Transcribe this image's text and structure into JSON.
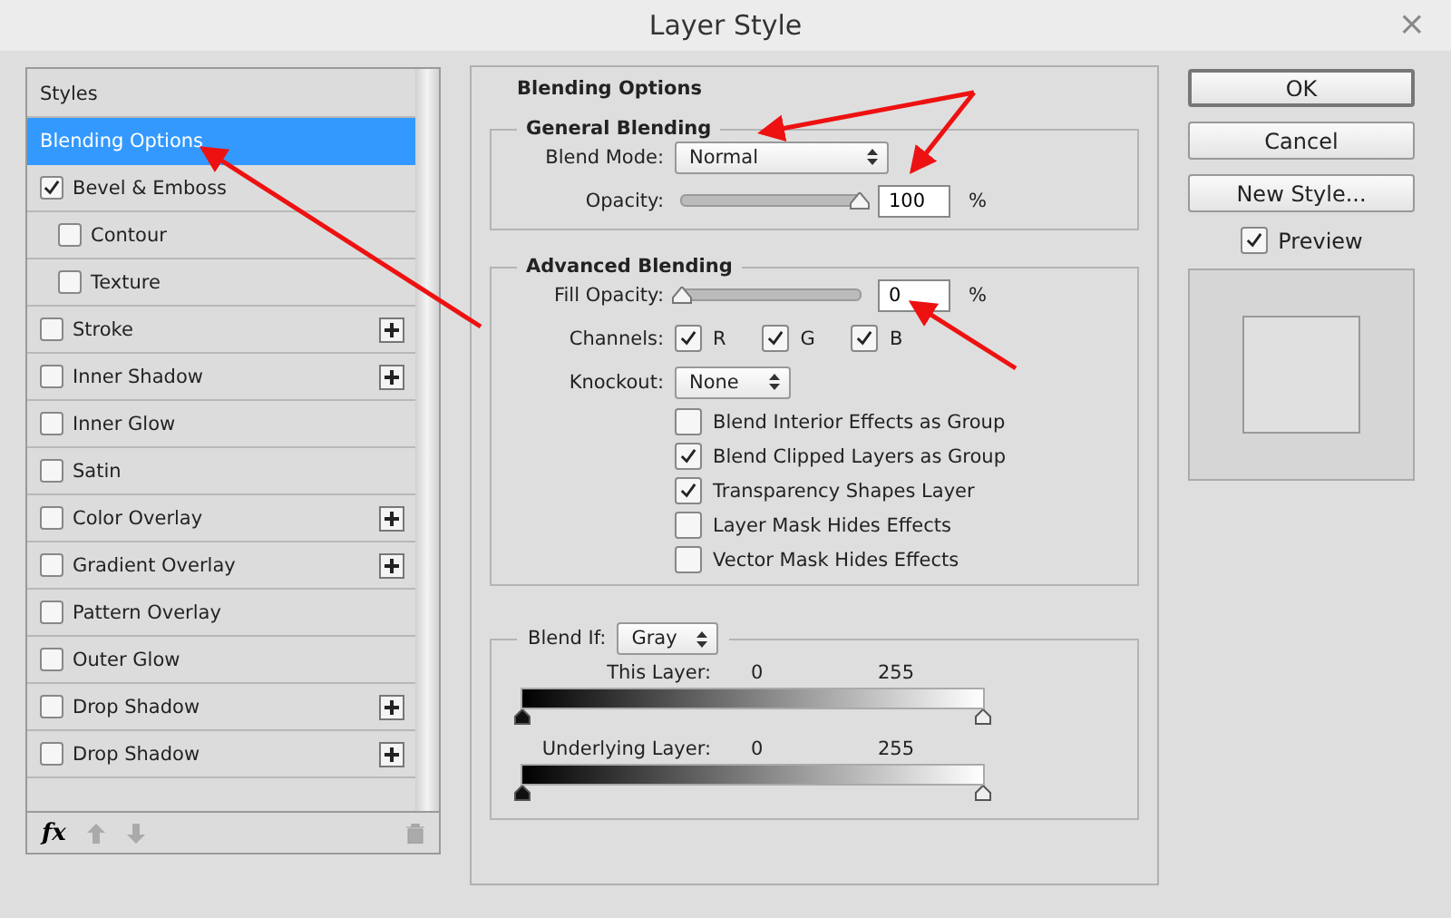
{
  "window": {
    "title": "Layer Style",
    "close": "×"
  },
  "sidebar": {
    "items": [
      {
        "kind": "header",
        "label": "Styles",
        "selected": false
      },
      {
        "kind": "header",
        "label": "Blending Options",
        "selected": true
      },
      {
        "kind": "effect",
        "label": "Bevel & Emboss",
        "checked": true,
        "selected": false,
        "add": false,
        "children": [
          {
            "kind": "effect",
            "label": "Contour",
            "checked": false,
            "selected": false,
            "add": false
          },
          {
            "kind": "effect",
            "label": "Texture",
            "checked": false,
            "selected": false,
            "add": false
          }
        ]
      },
      {
        "kind": "effect",
        "label": "Stroke",
        "checked": false,
        "selected": false,
        "add": true
      },
      {
        "kind": "effect",
        "label": "Inner Shadow",
        "checked": false,
        "selected": false,
        "add": true
      },
      {
        "kind": "effect",
        "label": "Inner Glow",
        "checked": false,
        "selected": false,
        "add": false
      },
      {
        "kind": "effect",
        "label": "Satin",
        "checked": false,
        "selected": false,
        "add": false
      },
      {
        "kind": "effect",
        "label": "Color Overlay",
        "checked": false,
        "selected": false,
        "add": true
      },
      {
        "kind": "effect",
        "label": "Gradient Overlay",
        "checked": false,
        "selected": false,
        "add": true
      },
      {
        "kind": "effect",
        "label": "Pattern Overlay",
        "checked": false,
        "selected": false,
        "add": false
      },
      {
        "kind": "effect",
        "label": "Outer Glow",
        "checked": false,
        "selected": false,
        "add": false
      },
      {
        "kind": "effect",
        "label": "Drop Shadow",
        "checked": false,
        "selected": false,
        "add": true
      },
      {
        "kind": "effect",
        "label": "Drop Shadow",
        "checked": false,
        "selected": false,
        "add": true
      }
    ],
    "footer": {
      "fx": "fx"
    }
  },
  "blending_options": {
    "title": "Blending Options",
    "general": {
      "title": "General Blending",
      "blend_mode": {
        "label": "Blend Mode:",
        "value": "Normal"
      },
      "opacity": {
        "label": "Opacity:",
        "level": 1,
        "value": "100",
        "unit": "%"
      }
    },
    "advanced": {
      "title": "Advanced Blending",
      "fill_opacity": {
        "label": "Fill Opacity:",
        "level": 0,
        "value": "0",
        "unit": "%"
      },
      "channels": {
        "label": "Channels:",
        "items": [
          {
            "label": "R",
            "checked": true
          },
          {
            "label": "G",
            "checked": true
          },
          {
            "label": "B",
            "checked": true
          }
        ]
      },
      "knockout": {
        "label": "Knockout:",
        "value": "None"
      },
      "options": [
        {
          "label": "Blend Interior Effects as Group",
          "checked": false
        },
        {
          "label": "Blend Clipped Layers as Group",
          "checked": true
        },
        {
          "label": "Transparency Shapes Layer",
          "checked": true
        },
        {
          "label": "Layer Mask Hides Effects",
          "checked": false
        },
        {
          "label": "Vector Mask Hides Effects",
          "checked": false
        }
      ]
    },
    "blend_if": {
      "label": "Blend If:",
      "value": "Gray",
      "layers": [
        {
          "label": "This Layer:",
          "low": "0",
          "high": "255"
        },
        {
          "label": "Underlying Layer:",
          "low": "0",
          "high": "255"
        }
      ]
    }
  },
  "buttons": [
    {
      "label": "OK",
      "default": true
    },
    {
      "label": "Cancel",
      "default": false
    },
    {
      "label": "New Style...",
      "default": false
    }
  ],
  "preview": {
    "label": "Preview",
    "checked": true
  }
}
